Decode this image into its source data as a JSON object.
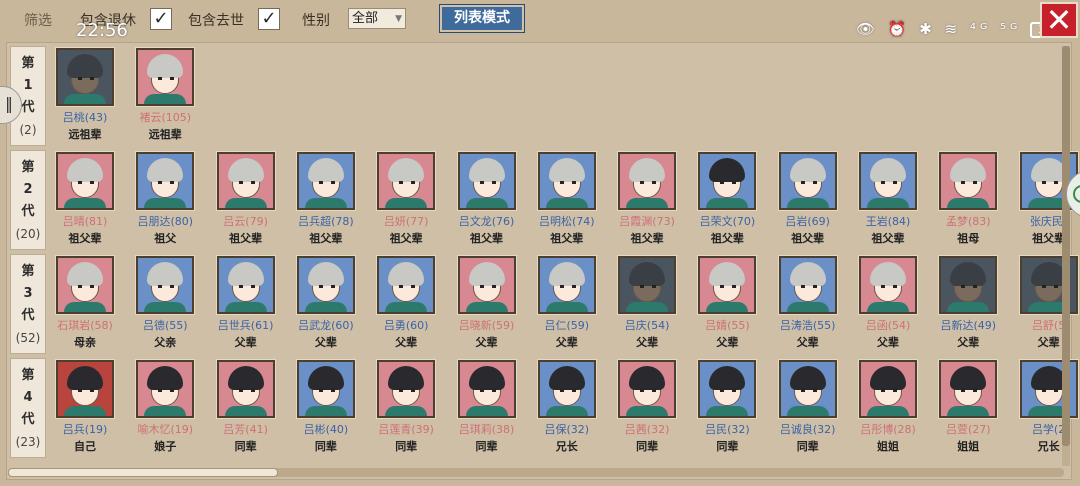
{
  "filter": {
    "title": "筛选",
    "retired_label": "包含退休",
    "retired_checked": "✓",
    "dead_label": "包含去世",
    "dead_checked": "✓",
    "gender_label": "性别",
    "gender_value": "全部",
    "list_mode_label": "列表模式"
  },
  "status": {
    "clock": "22:56",
    "icons": "👁 ⏰ ✱ ≋ ⁴ᴳ ⁵ᴳ",
    "battery": "39"
  },
  "close_label": "✕",
  "colors": {
    "male_name": "#3a63a8",
    "female_name": "#d06f76",
    "blue_bg": "#6b90c8",
    "pink_bg": "#d88891"
  },
  "generations": [
    {
      "label": [
        "第",
        "1",
        "代"
      ],
      "count": "(2)",
      "members": [
        {
          "name": "吕桃(43)",
          "relation": "远祖辈",
          "gender": "m",
          "bg": "dark",
          "hair": "black"
        },
        {
          "name": "褚云(105)",
          "relation": "远祖辈",
          "gender": "f",
          "bg": "pink",
          "hair": "grey"
        }
      ]
    },
    {
      "label": [
        "第",
        "2",
        "代"
      ],
      "count": "(20)",
      "members": [
        {
          "name": "吕晴(81)",
          "relation": "祖父辈",
          "gender": "f",
          "bg": "pink",
          "hair": "grey"
        },
        {
          "name": "吕朋达(80)",
          "relation": "祖父",
          "gender": "m",
          "bg": "blue",
          "hair": "grey"
        },
        {
          "name": "吕云(79)",
          "relation": "祖父辈",
          "gender": "f",
          "bg": "pink",
          "hair": "grey"
        },
        {
          "name": "吕兵超(78)",
          "relation": "祖父辈",
          "gender": "m",
          "bg": "blue",
          "hair": "grey"
        },
        {
          "name": "吕妍(77)",
          "relation": "祖父辈",
          "gender": "f",
          "bg": "pink",
          "hair": "grey"
        },
        {
          "name": "吕文龙(76)",
          "relation": "祖父辈",
          "gender": "m",
          "bg": "blue",
          "hair": "grey"
        },
        {
          "name": "吕明松(74)",
          "relation": "祖父辈",
          "gender": "m",
          "bg": "blue",
          "hair": "grey"
        },
        {
          "name": "吕霞渊(73)",
          "relation": "祖父辈",
          "gender": "f",
          "bg": "pink",
          "hair": "grey"
        },
        {
          "name": "吕荣文(70)",
          "relation": "祖父辈",
          "gender": "m",
          "bg": "blue",
          "hair": "black"
        },
        {
          "name": "吕岩(69)",
          "relation": "祖父辈",
          "gender": "m",
          "bg": "blue",
          "hair": "grey"
        },
        {
          "name": "王岩(84)",
          "relation": "祖父辈",
          "gender": "m",
          "bg": "blue",
          "hair": "grey"
        },
        {
          "name": "孟梦(83)",
          "relation": "祖母",
          "gender": "f",
          "bg": "pink",
          "hair": "grey"
        },
        {
          "name": "张庆民(",
          "relation": "祖父辈",
          "gender": "m",
          "bg": "blue",
          "hair": "grey"
        }
      ]
    },
    {
      "label": [
        "第",
        "3",
        "代"
      ],
      "count": "(52)",
      "members": [
        {
          "name": "石琪岩(58)",
          "relation": "母亲",
          "gender": "f",
          "bg": "pink",
          "hair": "grey"
        },
        {
          "name": "吕德(55)",
          "relation": "父亲",
          "gender": "m",
          "bg": "blue",
          "hair": "grey"
        },
        {
          "name": "吕世兵(61)",
          "relation": "父辈",
          "gender": "m",
          "bg": "blue",
          "hair": "grey"
        },
        {
          "name": "吕武龙(60)",
          "relation": "父辈",
          "gender": "m",
          "bg": "blue",
          "hair": "grey"
        },
        {
          "name": "吕勇(60)",
          "relation": "父辈",
          "gender": "m",
          "bg": "blue",
          "hair": "grey"
        },
        {
          "name": "吕晓新(59)",
          "relation": "父辈",
          "gender": "f",
          "bg": "pink",
          "hair": "grey"
        },
        {
          "name": "吕仁(59)",
          "relation": "父辈",
          "gender": "m",
          "bg": "blue",
          "hair": "grey"
        },
        {
          "name": "吕庆(54)",
          "relation": "父辈",
          "gender": "m",
          "bg": "dark",
          "hair": "black"
        },
        {
          "name": "吕婧(55)",
          "relation": "父辈",
          "gender": "f",
          "bg": "pink",
          "hair": "grey"
        },
        {
          "name": "吕涛浩(55)",
          "relation": "父辈",
          "gender": "m",
          "bg": "blue",
          "hair": "grey"
        },
        {
          "name": "吕函(54)",
          "relation": "父辈",
          "gender": "f",
          "bg": "pink",
          "hair": "grey"
        },
        {
          "name": "吕新达(49)",
          "relation": "父辈",
          "gender": "m",
          "bg": "dark",
          "hair": "black"
        },
        {
          "name": "吕舒(5",
          "relation": "父辈",
          "gender": "f",
          "bg": "dark",
          "hair": "black"
        }
      ]
    },
    {
      "label": [
        "第",
        "4",
        "代"
      ],
      "count": "(23)",
      "members": [
        {
          "name": "吕兵(19)",
          "relation": "自己",
          "gender": "m",
          "bg": "red-pattern",
          "hair": "black"
        },
        {
          "name": "喻木忆(19)",
          "relation": "娘子",
          "gender": "f",
          "bg": "pink",
          "hair": "black"
        },
        {
          "name": "吕芳(41)",
          "relation": "同辈",
          "gender": "f",
          "bg": "pink",
          "hair": "black"
        },
        {
          "name": "吕彬(40)",
          "relation": "同辈",
          "gender": "m",
          "bg": "blue",
          "hair": "black"
        },
        {
          "name": "吕莲青(39)",
          "relation": "同辈",
          "gender": "f",
          "bg": "pink",
          "hair": "black"
        },
        {
          "name": "吕琪莉(38)",
          "relation": "同辈",
          "gender": "f",
          "bg": "pink",
          "hair": "black"
        },
        {
          "name": "吕保(32)",
          "relation": "兄长",
          "gender": "m",
          "bg": "blue",
          "hair": "black"
        },
        {
          "name": "吕茜(32)",
          "relation": "同辈",
          "gender": "f",
          "bg": "pink",
          "hair": "black"
        },
        {
          "name": "吕民(32)",
          "relation": "同辈",
          "gender": "m",
          "bg": "blue",
          "hair": "black"
        },
        {
          "name": "吕诚良(32)",
          "relation": "同辈",
          "gender": "m",
          "bg": "blue",
          "hair": "black"
        },
        {
          "name": "吕彤博(28)",
          "relation": "姐姐",
          "gender": "f",
          "bg": "pink",
          "hair": "black"
        },
        {
          "name": "吕萱(27)",
          "relation": "姐姐",
          "gender": "f",
          "bg": "pink",
          "hair": "black"
        },
        {
          "name": "吕学(2",
          "relation": "兄长",
          "gender": "m",
          "bg": "blue",
          "hair": "black"
        }
      ]
    }
  ]
}
